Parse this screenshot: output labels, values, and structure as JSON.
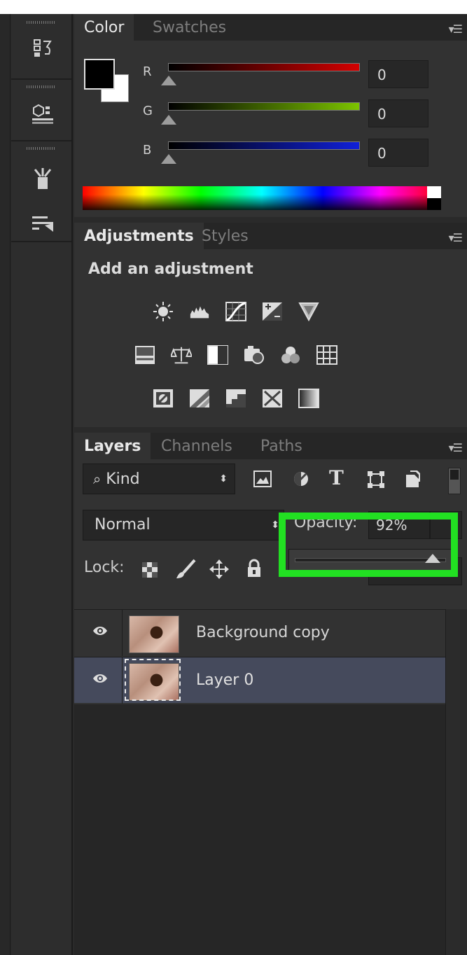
{
  "toolstrip": {
    "icons": [
      "history-icon",
      "3d-cube-icon",
      "brush-tools-icon",
      "tool-presets-icon"
    ]
  },
  "color_panel": {
    "tabs": [
      "Color",
      "Swatches"
    ],
    "active_tab": "Color",
    "channels": [
      {
        "label": "R",
        "value": "0",
        "color": "#d40000"
      },
      {
        "label": "G",
        "value": "0",
        "color": "#7cc400"
      },
      {
        "label": "B",
        "value": "0",
        "color": "#1020d8"
      }
    ],
    "foreground_color": "#000000",
    "background_color": "#ffffff"
  },
  "adjustments_panel": {
    "tabs": [
      "Adjustments",
      "Styles"
    ],
    "active_tab": "Adjustments",
    "heading": "Add an adjustment",
    "icons": [
      [
        "brightness-contrast-icon",
        "levels-icon",
        "curves-icon",
        "exposure-icon",
        "vibrance-icon"
      ],
      [
        "hue-saturation-icon",
        "color-balance-icon",
        "black-white-icon",
        "photo-filter-icon",
        "channel-mixer-icon",
        "color-lookup-icon"
      ],
      [
        "invert-icon",
        "posterize-icon",
        "threshold-icon",
        "selective-color-icon",
        "gradient-map-icon"
      ]
    ]
  },
  "layers_panel": {
    "tabs": [
      "Layers",
      "Channels",
      "Paths"
    ],
    "active_tab": "Layers",
    "filter_kind": "Kind",
    "blend_mode": "Normal",
    "opacity_label": "Opacity:",
    "opacity_value": "92%",
    "opacity_slider_fraction": 0.92,
    "lock_label": "Lock:",
    "layers": [
      {
        "name": "Background copy",
        "selected": false,
        "visible": true
      },
      {
        "name": "Layer 0",
        "selected": true,
        "visible": true
      }
    ]
  },
  "highlight_color": "#22e022"
}
